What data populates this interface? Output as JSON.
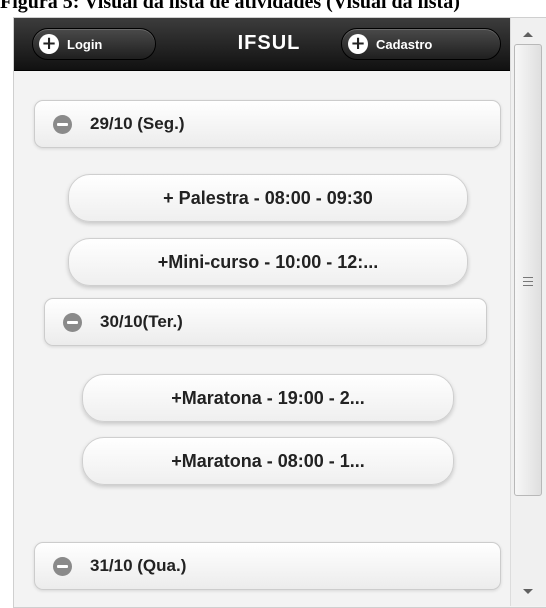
{
  "caption": "Figura 5: Visual da lista de atividades (Visual da lista)",
  "header": {
    "title": "IFSUL",
    "login_label": "Login",
    "signup_label": "Cadastro"
  },
  "days": [
    {
      "label": "29/10 (Seg.)",
      "events": [
        "+ Palestra - 08:00 - 09:30",
        "+Mini-curso - 10:00 - 12:..."
      ]
    },
    {
      "label": "30/10(Ter.)",
      "events": [
        "+Maratona - 19:00 - 2...",
        "+Maratona - 08:00 - 1..."
      ]
    },
    {
      "label": "31/10 (Qua.)",
      "events": []
    }
  ],
  "icons": {
    "add": "plus-circle-icon",
    "collapse": "minus-circle-icon",
    "scroll_up": "arrow-up-icon",
    "scroll_down": "arrow-down-icon",
    "grip": "scroll-grip-icon"
  },
  "colors": {
    "header_bg": "#1a1a1a",
    "body_bg": "#f3f3f3",
    "icon_gray": "#8a8a8a"
  }
}
